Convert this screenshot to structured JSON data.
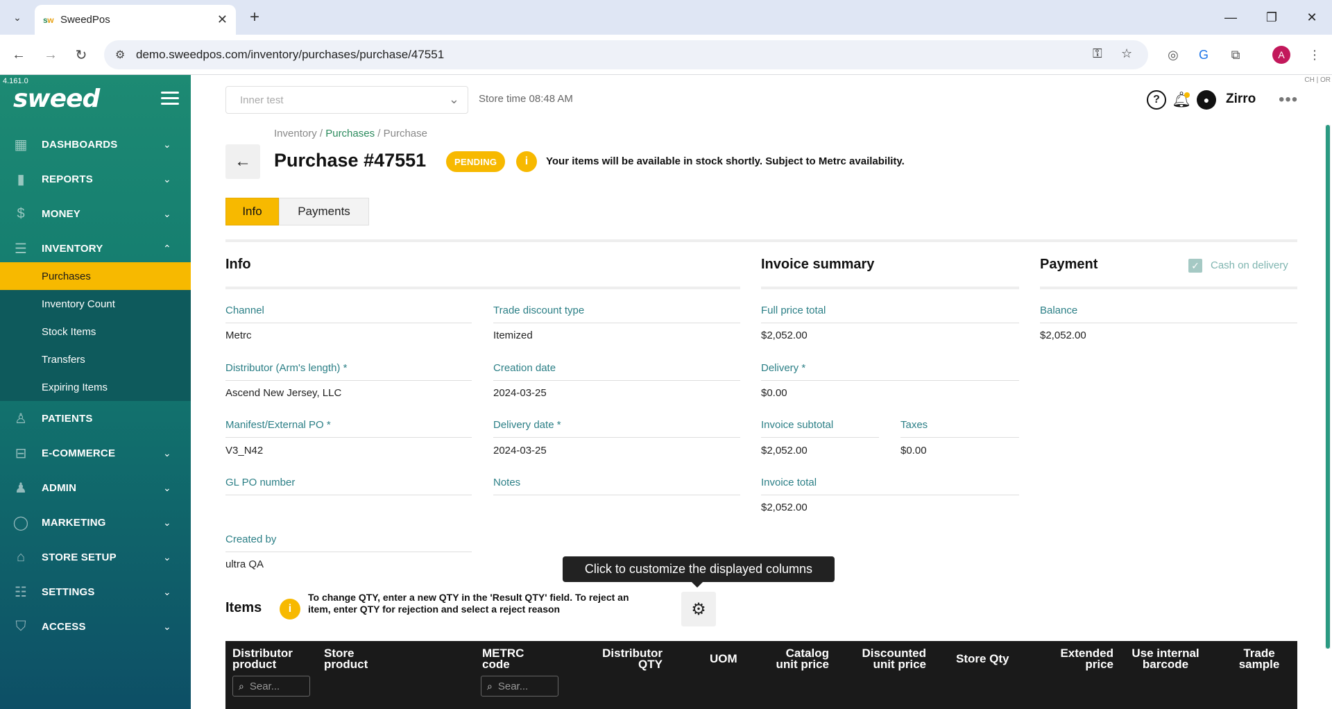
{
  "browser": {
    "tab_title": "SweedPos",
    "url": "demo.sweedpos.com/inventory/purchases/purchase/47551",
    "profile_initial": "A"
  },
  "app": {
    "version": "4.161.0",
    "logo": "sweed",
    "store_placeholder": "Inner test",
    "store_time": "Store time 08:48 AM",
    "locale": "CH | OR",
    "user_name": "Zirro"
  },
  "sidebar": {
    "items": [
      {
        "label": "DASHBOARDS"
      },
      {
        "label": "REPORTS"
      },
      {
        "label": "MONEY"
      },
      {
        "label": "INVENTORY"
      },
      {
        "label": "PATIENTS"
      },
      {
        "label": "E-COMMERCE"
      },
      {
        "label": "ADMIN"
      },
      {
        "label": "MARKETING"
      },
      {
        "label": "STORE SETUP"
      },
      {
        "label": "SETTINGS"
      },
      {
        "label": "ACCESS"
      }
    ],
    "inventory_sub": [
      {
        "label": "Purchases",
        "active": true
      },
      {
        "label": "Inventory Count"
      },
      {
        "label": "Stock Items"
      },
      {
        "label": "Transfers"
      },
      {
        "label": "Expiring Items"
      }
    ]
  },
  "page": {
    "breadcrumb": {
      "root": "Inventory",
      "parent": "Purchases",
      "current": "Purchase",
      "sep": " / "
    },
    "title": "Purchase #47551",
    "status": "PENDING",
    "status_message": "Your items will be available in stock shortly. Subject to Metrc availability.",
    "tabs": [
      {
        "label": "Info"
      },
      {
        "label": "Payments"
      }
    ]
  },
  "info": {
    "title": "Info",
    "channel": {
      "label": "Channel",
      "value": "Metrc"
    },
    "trade_discount_type": {
      "label": "Trade discount type",
      "value": "Itemized"
    },
    "distributor": {
      "label": "Distributor (Arm's length) *",
      "value": "Ascend New Jersey, LLC"
    },
    "creation_date": {
      "label": "Creation date",
      "value": "2024-03-25"
    },
    "manifest": {
      "label": "Manifest/External PO *",
      "value": "V3_N42"
    },
    "delivery_date": {
      "label": "Delivery date *",
      "value": "2024-03-25"
    },
    "gl_po": {
      "label": "GL PO number",
      "value": ""
    },
    "notes": {
      "label": "Notes",
      "value": ""
    },
    "created_by": {
      "label": "Created by",
      "value": "ultra QA"
    }
  },
  "invoice_summary": {
    "title": "Invoice summary",
    "full_price_total": {
      "label": "Full price total",
      "value": "$2,052.00"
    },
    "delivery": {
      "label": "Delivery *",
      "value": "$0.00"
    },
    "invoice_subtotal": {
      "label": "Invoice subtotal",
      "value": "$2,052.00"
    },
    "taxes": {
      "label": "Taxes",
      "value": "$0.00"
    },
    "invoice_total": {
      "label": "Invoice total",
      "value": "$2,052.00"
    }
  },
  "payment": {
    "title": "Payment",
    "cash_on_delivery": {
      "label": "Cash on delivery",
      "checked": true
    },
    "balance": {
      "label": "Balance",
      "value": "$2,052.00"
    }
  },
  "items": {
    "title": "Items",
    "hint": "To change QTY, enter a new QTY in the 'Result QTY' field. To reject an item, enter QTY for rejection and select a reject reason",
    "tooltip": "Click to customize the displayed columns",
    "search_placeholder": "Sear...",
    "columns": [
      {
        "l1": "Distributor",
        "l2": "product"
      },
      {
        "l1": "Store",
        "l2": "product"
      },
      {
        "l1": "METRC",
        "l2": "code"
      },
      {
        "l1": "Distributor",
        "l2": "QTY"
      },
      {
        "l1": "UOM",
        "l2": ""
      },
      {
        "l1": "Catalog",
        "l2": "unit price"
      },
      {
        "l1": "Discounted",
        "l2": "unit price"
      },
      {
        "l1": "Store Qty",
        "l2": ""
      },
      {
        "l1": "Extended",
        "l2": "price"
      },
      {
        "l1": "Use internal",
        "l2": "barcode"
      },
      {
        "l1": "Trade",
        "l2": "sample"
      }
    ]
  },
  "colors": {
    "accent": "#f7b900",
    "sidebar_top": "#1d8a73",
    "sidebar_bottom": "#0d4f66",
    "label_teal": "#2b7f86"
  }
}
